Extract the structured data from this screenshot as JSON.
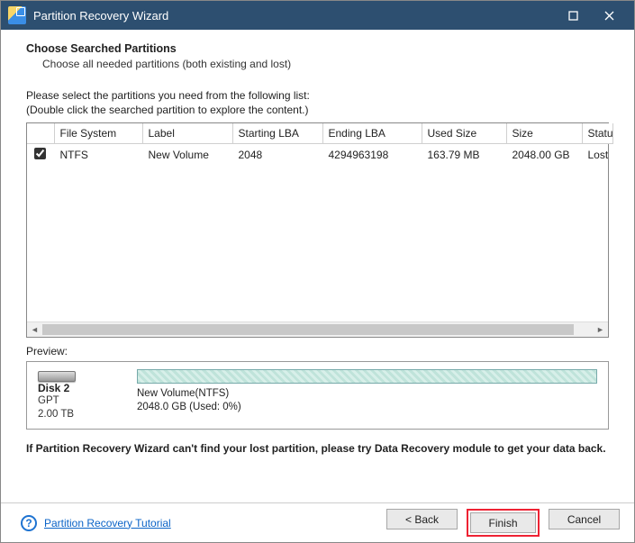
{
  "window": {
    "title": "Partition Recovery Wizard"
  },
  "header": {
    "title": "Choose Searched Partitions",
    "subtitle": "Choose all needed partitions (both existing and lost)"
  },
  "instructions": {
    "line1": "Please select the partitions you need from the following list:",
    "line2": "(Double click the searched partition to explore the content.)"
  },
  "table": {
    "cols": [
      "File System",
      "Label",
      "Starting LBA",
      "Ending LBA",
      "Used Size",
      "Size",
      "Statu"
    ],
    "rows": [
      {
        "checked": true,
        "cells": [
          "NTFS",
          "New Volume",
          "2048",
          "4294963198",
          "163.79 MB",
          "2048.00 GB",
          "Lost/"
        ]
      }
    ]
  },
  "preview": {
    "label": "Preview:",
    "disk_name": "Disk 2",
    "disk_type": "GPT",
    "disk_size": "2.00 TB",
    "vol_line1": "New Volume(NTFS)",
    "vol_line2": "2048.0 GB (Used: 0%)"
  },
  "warning": "If Partition Recovery Wizard can't find your lost partition, please try Data Recovery module to get your data back.",
  "footer": {
    "tutorial": "Partition Recovery Tutorial",
    "back": "<  Back",
    "finish": "Finish",
    "cancel": "Cancel"
  }
}
